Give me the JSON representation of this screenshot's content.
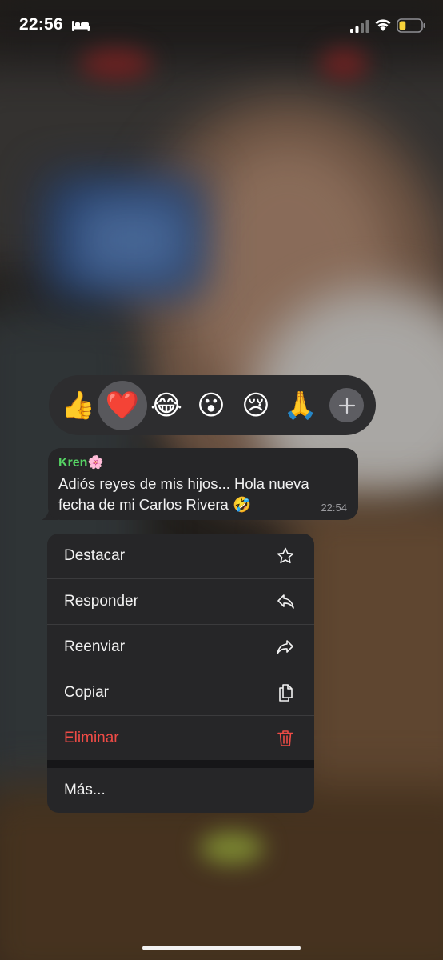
{
  "status_bar": {
    "time": "22:56",
    "icons": [
      "bed-icon",
      "signal-icon",
      "wifi-icon",
      "battery-icon"
    ],
    "battery_level": 0.3,
    "battery_color": "#f7d33a"
  },
  "reactions": {
    "items": [
      "👍",
      "❤️",
      "😂",
      "😮",
      "😢",
      "🙏"
    ],
    "selected_index": 1,
    "more_icon": "plus-icon"
  },
  "message": {
    "sender": "Kren🌸",
    "sender_color": "#56d364",
    "text": "Adiós reyes de mis hijos... Hola nueva fecha de mi Carlos Rivera 🤣",
    "time": "22:54"
  },
  "menu": {
    "items": [
      {
        "label": "Destacar",
        "icon": "star-icon"
      },
      {
        "label": "Responder",
        "icon": "reply-icon"
      },
      {
        "label": "Reenviar",
        "icon": "forward-icon"
      },
      {
        "label": "Copiar",
        "icon": "copy-icon"
      },
      {
        "label": "Eliminar",
        "icon": "trash-icon",
        "destructive": true
      },
      {
        "label": "Más..."
      }
    ],
    "destructive_color": "#ef4b46"
  }
}
